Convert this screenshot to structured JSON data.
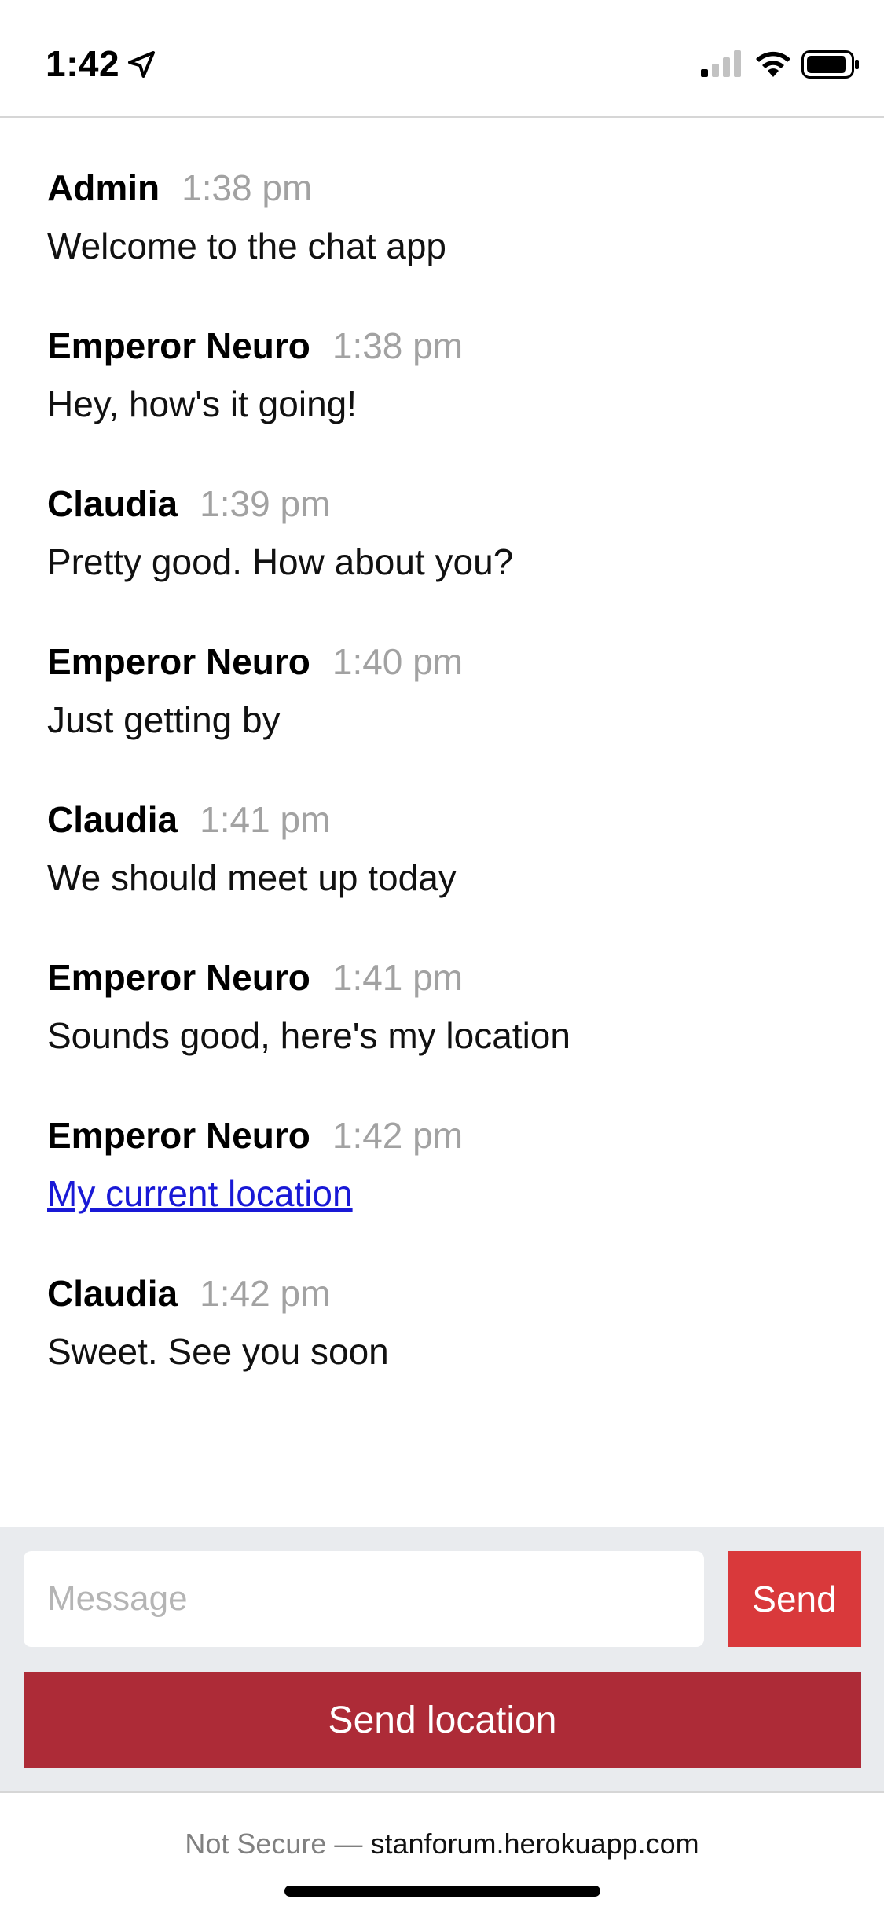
{
  "status_bar": {
    "time": "1:42",
    "icons": [
      "location-arrow-icon",
      "signal-icon",
      "wifi-icon",
      "battery-icon"
    ]
  },
  "messages": [
    {
      "name": "Admin",
      "time": "1:38 pm",
      "text": "Welcome to the chat app",
      "is_link": false
    },
    {
      "name": "Emperor Neuro",
      "time": "1:38 pm",
      "text": "Hey, how's it going!",
      "is_link": false
    },
    {
      "name": "Claudia",
      "time": "1:39 pm",
      "text": "Pretty good. How about you?",
      "is_link": false
    },
    {
      "name": "Emperor Neuro",
      "time": "1:40 pm",
      "text": "Just getting by",
      "is_link": false
    },
    {
      "name": "Claudia",
      "time": "1:41 pm",
      "text": "We should meet up today",
      "is_link": false
    },
    {
      "name": "Emperor Neuro",
      "time": "1:41 pm",
      "text": "Sounds good, here's my location",
      "is_link": false
    },
    {
      "name": "Emperor Neuro",
      "time": "1:42 pm",
      "text": "My current location",
      "is_link": true
    },
    {
      "name": "Claudia",
      "time": "1:42 pm",
      "text": "Sweet. See you soon",
      "is_link": false
    }
  ],
  "compose": {
    "message_placeholder": "Message",
    "message_value": "",
    "send_label": "Send",
    "send_location_label": "Send location"
  },
  "browser": {
    "security_label": "Not Secure —",
    "host": "stanforum.herokuapp.com"
  },
  "colors": {
    "send_button": "#d9393b",
    "send_location_button": "#ad2b37",
    "link": "#1919d6",
    "timestamp": "#a2a2a2",
    "compose_bg": "#e9ebee"
  }
}
